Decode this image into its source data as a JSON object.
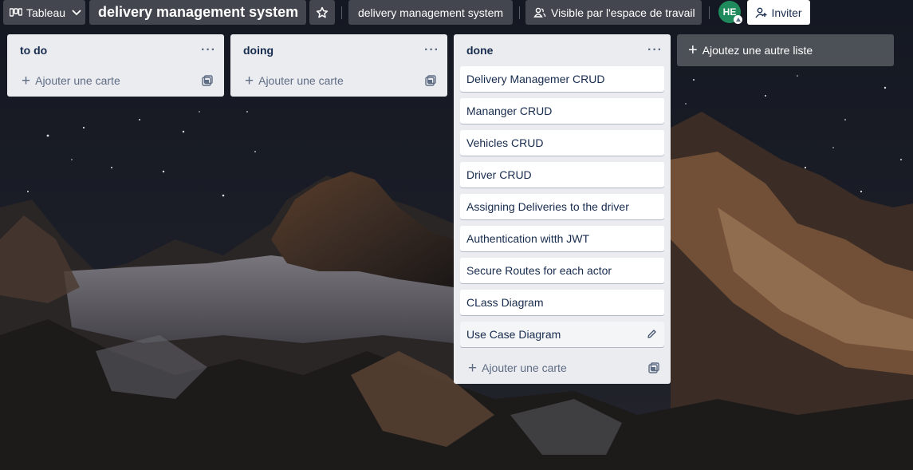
{
  "header": {
    "view_label": "Tableau",
    "board_title": "delivery management system",
    "workspace_label": "delivery management system",
    "visibility_label": "Visible par l'espace de travail",
    "avatar_initials": "HE",
    "invite_label": "Inviter"
  },
  "lists": [
    {
      "title": "to do",
      "menu": "···",
      "cards": [],
      "add_card_label": "Ajouter une carte"
    },
    {
      "title": "doing",
      "menu": "···",
      "cards": [],
      "add_card_label": "Ajouter une carte"
    },
    {
      "title": "done",
      "menu": "···",
      "cards": [
        "Delivery Managemer CRUD",
        "Mananger CRUD",
        "Vehicles CRUD",
        "Driver CRUD",
        "Assigning Deliveries to the driver",
        "Authentication witth JWT",
        "Secure Routes for each actor",
        "CLass Diagram",
        "Use Case Diagram"
      ],
      "add_card_label": "Ajouter une carte"
    }
  ],
  "add_list_label": "Ajoutez une autre liste",
  "icons": {
    "view": "board-icon",
    "chevron": "chevron-down-icon",
    "star": "star-icon",
    "visibility": "people-icon",
    "invite": "add-user-icon",
    "template": "template-icon",
    "edit": "pencil-icon"
  },
  "colors": {
    "avatar": "#1f8a5b",
    "list_bg": "#ebecf0",
    "card_text": "#172b4d"
  }
}
